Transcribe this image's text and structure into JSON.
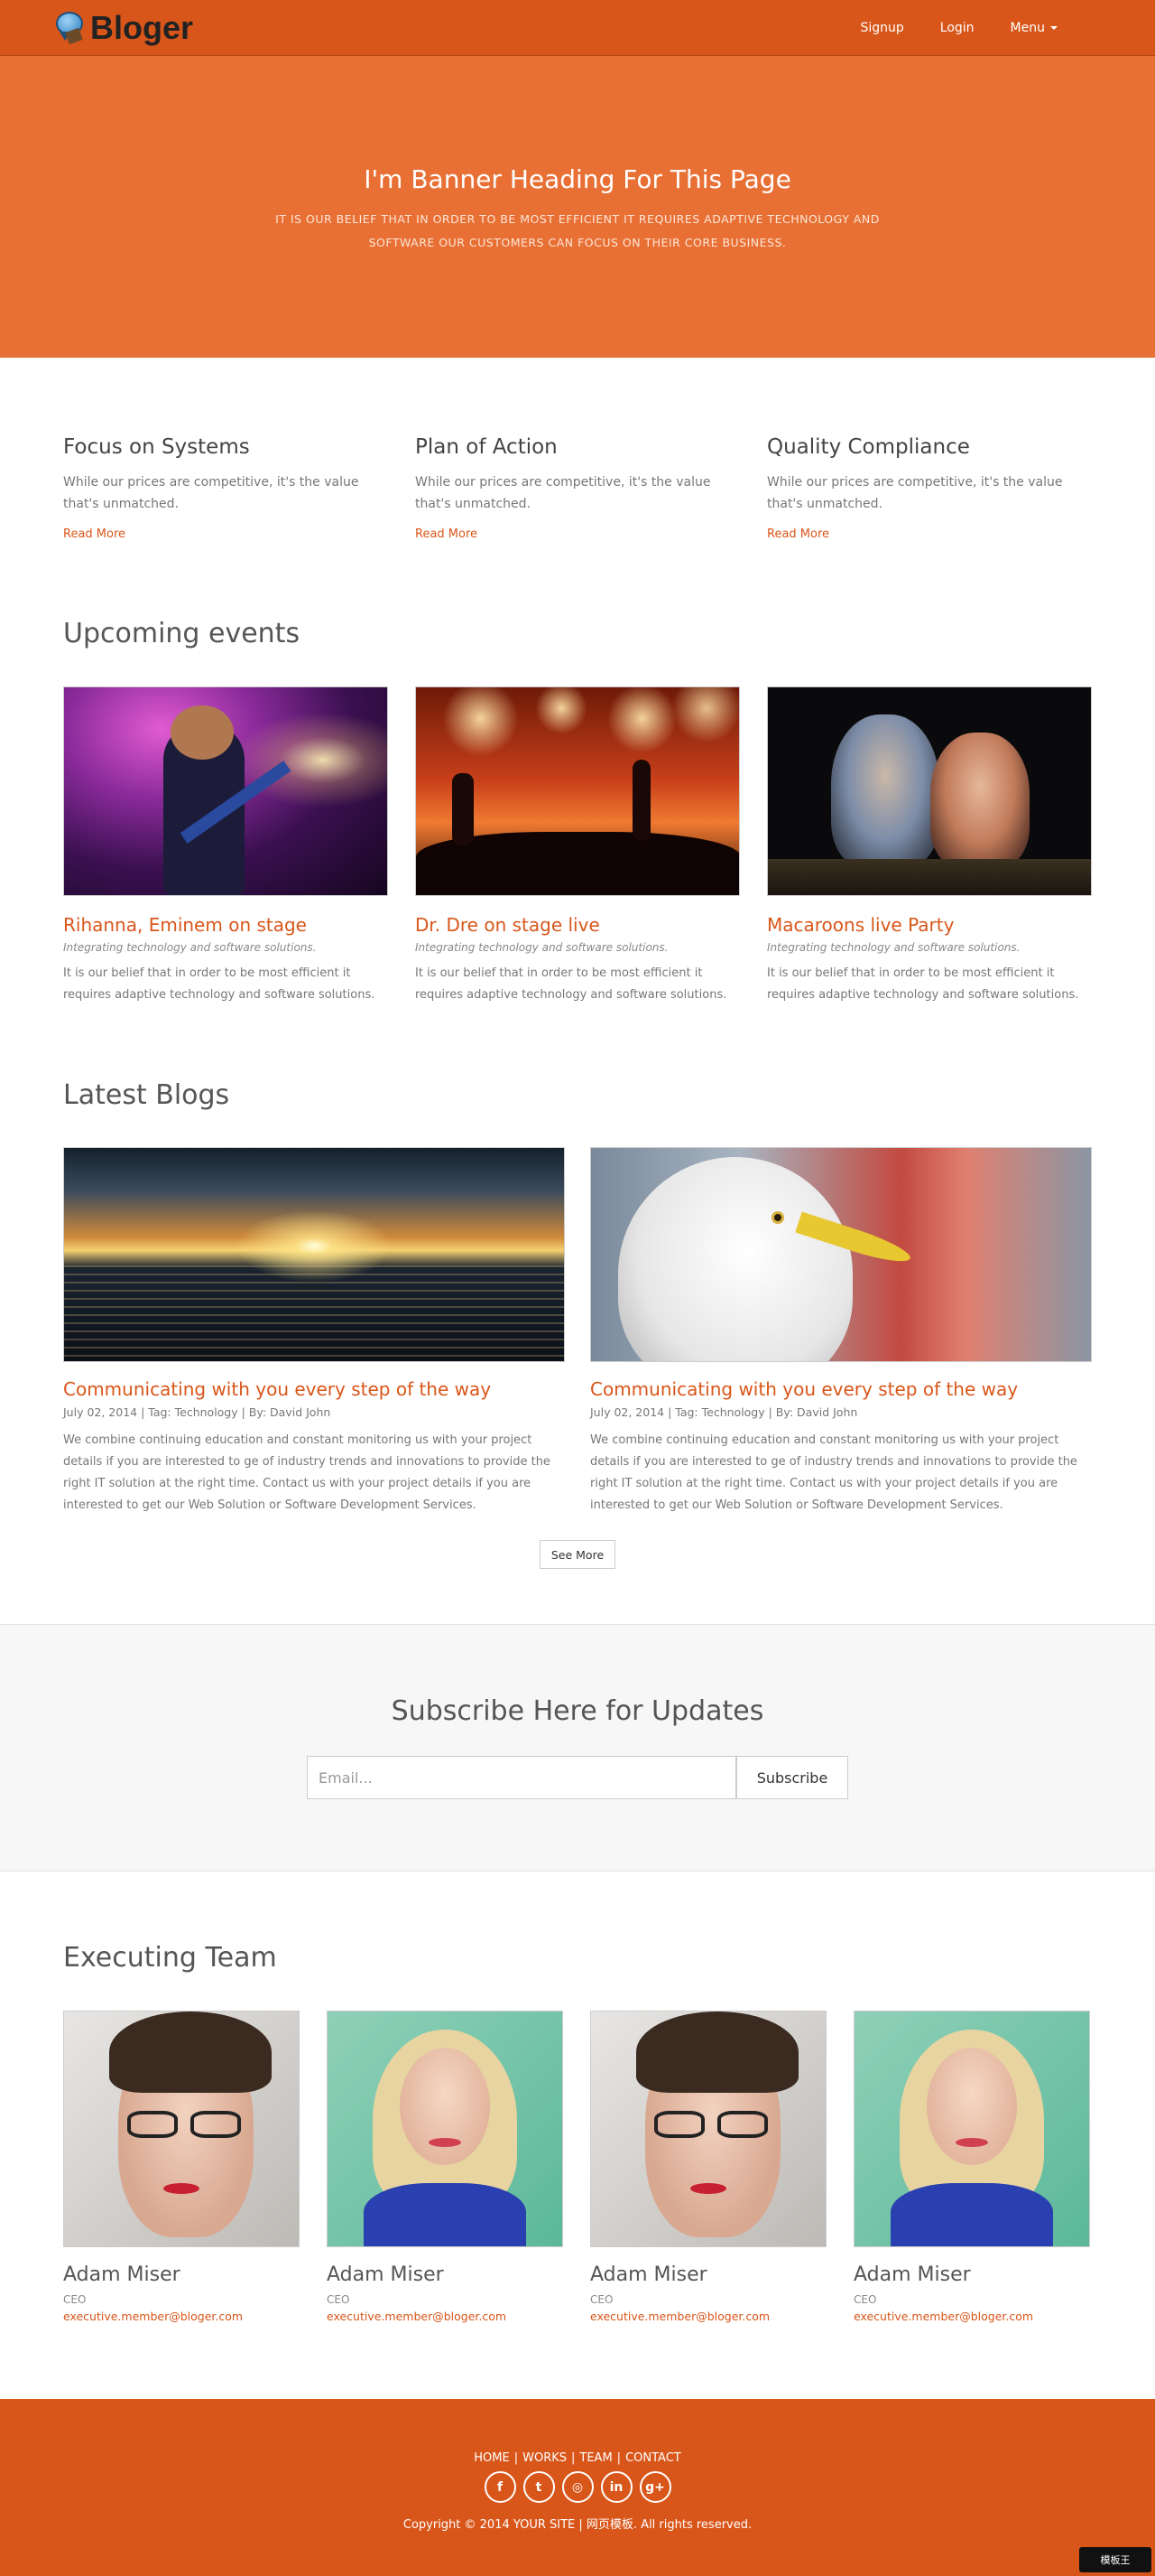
{
  "navbar": {
    "brand": "Bloger",
    "links": [
      {
        "label": "Signup"
      },
      {
        "label": "Login"
      },
      {
        "label": "Menu"
      }
    ]
  },
  "banner": {
    "heading": "I'm Banner Heading For This Page",
    "text": "IT IS OUR BELIEF THAT IN ORDER TO BE MOST EFFICIENT IT REQUIRES ADAPTIVE TECHNOLOGY AND SOFTWARE OUR CUSTOMERS CAN FOCUS ON THEIR CORE BUSINESS."
  },
  "features": [
    {
      "title": "Focus on Systems",
      "text": "While our prices are competitive, it's the value that's unmatched.",
      "link": "Read More"
    },
    {
      "title": "Plan of Action",
      "text": "While our prices are competitive, it's the value that's unmatched.",
      "link": "Read More"
    },
    {
      "title": "Quality Compliance",
      "text": "While our prices are competitive, it's the value that's unmatched.",
      "link": "Read More"
    }
  ],
  "events": {
    "title": "Upcoming events",
    "items": [
      {
        "title": "Rihanna, Eminem on stage",
        "subtitle": "Integrating technology and software solutions.",
        "text": "It is our belief that in order to be most efficient it requires adaptive technology and software solutions."
      },
      {
        "title": "Dr. Dre on stage live",
        "subtitle": "Integrating technology and software solutions.",
        "text": "It is our belief that in order to be most efficient it requires adaptive technology and software solutions."
      },
      {
        "title": "Macaroons live Party",
        "subtitle": "Integrating technology and software solutions.",
        "text": "It is our belief that in order to be most efficient it requires adaptive technology and software solutions."
      }
    ]
  },
  "blogs": {
    "title": "Latest Blogs",
    "items": [
      {
        "title": "Communicating with you every step of the way",
        "meta": "July 02, 2014 | Tag: Technology | By: David John",
        "text": "We combine continuing education and constant monitoring us with your project details if you are interested to ge of industry trends and innovations to provide the right IT solution at the right time. Contact us with your project details if you are interested to get our Web Solution or Software Development Services."
      },
      {
        "title": "Communicating with you every step of the way",
        "meta": "July 02, 2014 | Tag: Technology | By: David John",
        "text": "We combine continuing education and constant monitoring us with your project details if you are interested to ge of industry trends and innovations to provide the right IT solution at the right time. Contact us with your project details if you are interested to get our Web Solution or Software Development Services."
      }
    ],
    "see_more": "See More"
  },
  "subscribe": {
    "title": "Subscribe Here for Updates",
    "placeholder": "Email...",
    "button": "Subscribe"
  },
  "team": {
    "title": "Executing Team",
    "members": [
      {
        "name": "Adam Miser",
        "role": "CEO",
        "email": "executive.member@bloger.com"
      },
      {
        "name": "Adam Miser",
        "role": "CEO",
        "email": "executive.member@bloger.com"
      },
      {
        "name": "Adam Miser",
        "role": "CEO",
        "email": "executive.member@bloger.com"
      },
      {
        "name": "Adam Miser",
        "role": "CEO",
        "email": "executive.member@bloger.com"
      }
    ]
  },
  "footer": {
    "nav": [
      "HOME",
      "WORKS",
      "TEAM",
      "CONTACT"
    ],
    "socials": [
      {
        "icon": "facebook-icon",
        "glyph": "f"
      },
      {
        "icon": "twitter-icon",
        "glyph": "t"
      },
      {
        "icon": "dribbble-icon",
        "glyph": "◎"
      },
      {
        "icon": "linkedin-icon",
        "glyph": "in"
      },
      {
        "icon": "google-plus-icon",
        "glyph": "g+"
      }
    ],
    "copyright": "Copyright © 2014 YOUR SITE | 网页模板. All rights reserved.",
    "watermark": "模板王"
  },
  "colors": {
    "brand": "#d9561a",
    "banner": "#e87035"
  }
}
